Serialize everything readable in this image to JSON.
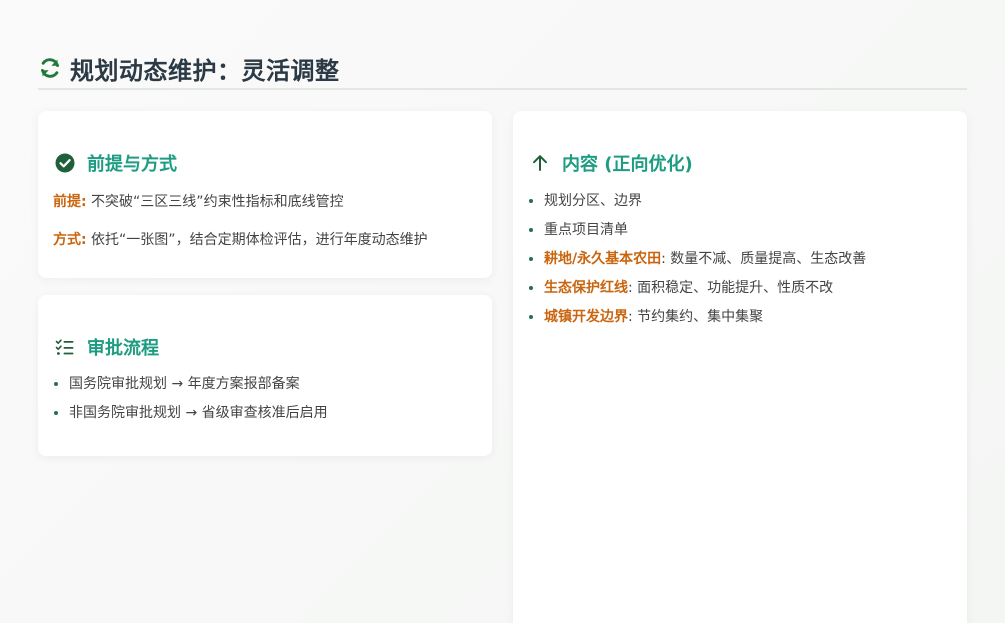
{
  "header": {
    "title": "规划动态维护：灵活调整",
    "icon": "refresh-icon",
    "icon_color": "#1f7a3a"
  },
  "premise_card": {
    "title": "前提与方式",
    "icon": "check-circle-icon",
    "rows": [
      {
        "label": "前提:",
        "text": " 不突破“三区三线”约束性指标和底线管控"
      },
      {
        "label": "方式:",
        "text": " 依托“一张图”，结合定期体检评估，进行年度动态维护"
      }
    ]
  },
  "approval_card": {
    "title": "审批流程",
    "icon": "checklist-icon",
    "items": [
      "国务院审批规划 → 年度方案报部备案",
      "非国务院审批规划 → 省级审查核准后启用"
    ]
  },
  "content_card": {
    "title": "内容 (正向优化)",
    "icon": "arrow-up-icon",
    "items": [
      {
        "label": "",
        "text": "规划分区、边界"
      },
      {
        "label": "",
        "text": "重点项目清单"
      },
      {
        "label": "耕地/永久基本农田",
        "text": ": 数量不减、质量提高、生态改善"
      },
      {
        "label": "生态保护红线",
        "text": ": 面积稳定、功能提升、性质不改"
      },
      {
        "label": "城镇开发边界",
        "text": ": 节约集约、集中集聚"
      }
    ]
  },
  "colors": {
    "accent_teal": "#1e9c82",
    "label_orange": "#c9650f",
    "title_dark": "#2b3a44",
    "icon_green": "#1f5f3a"
  }
}
